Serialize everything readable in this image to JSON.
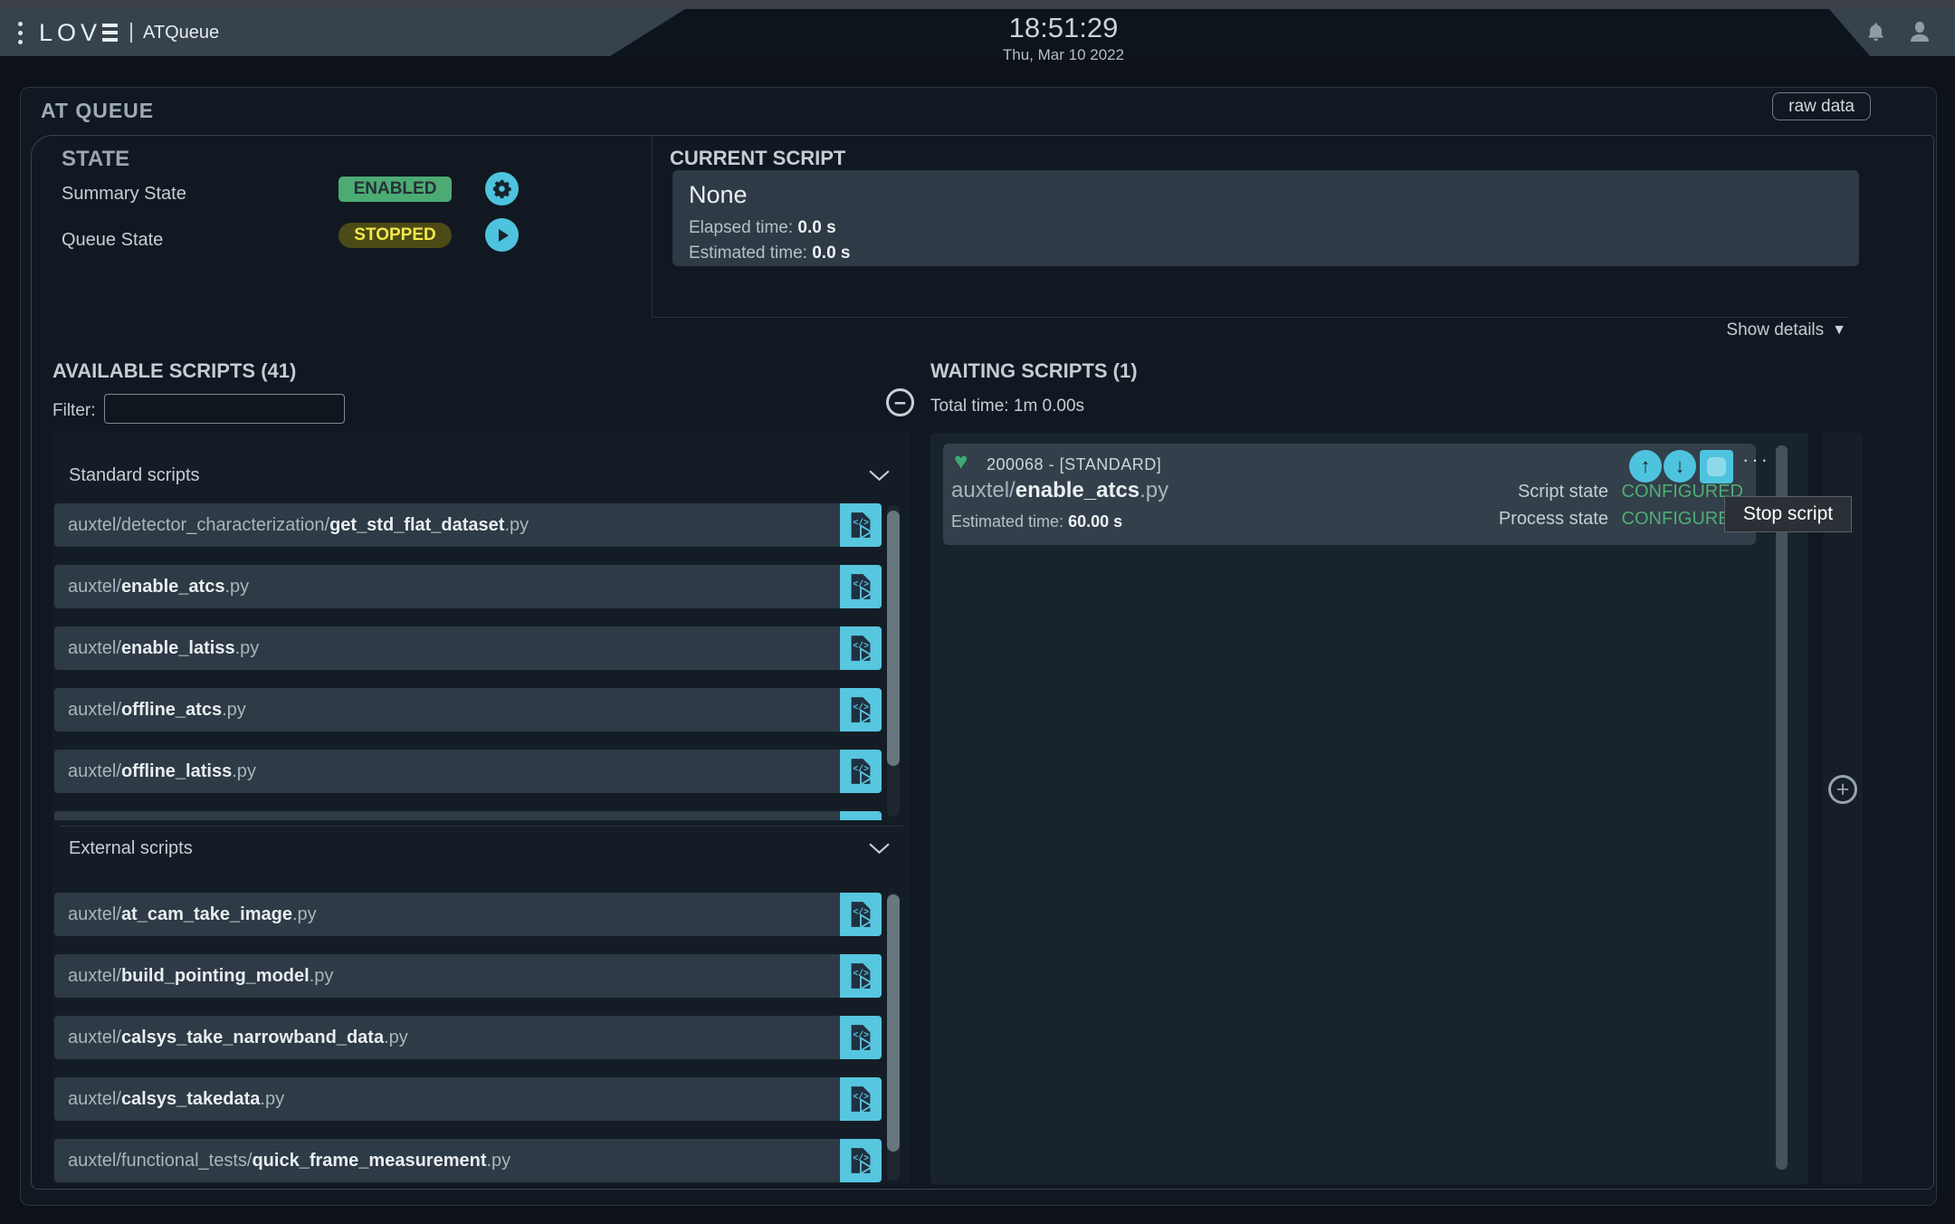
{
  "header": {
    "menu_icon": "kebab-menu",
    "logo_text": "LOV",
    "app_name": "ATQueue",
    "clock_time": "18:51:29",
    "clock_date": "Thu, Mar 10 2022"
  },
  "panel": {
    "title": "AT QUEUE",
    "raw_data_button": "raw data",
    "show_details": "Show details",
    "show_details_icon": "▼"
  },
  "state": {
    "title": "STATE",
    "summary_label": "Summary State",
    "summary_value": "ENABLED",
    "queue_label": "Queue State",
    "queue_value": "STOPPED"
  },
  "current_script": {
    "title": "CURRENT SCRIPT",
    "name": "None",
    "elapsed_label": "Elapsed time:",
    "elapsed_value": "0.0 s",
    "estimated_label": "Estimated time:",
    "estimated_value": "0.0 s"
  },
  "available": {
    "title": "AVAILABLE SCRIPTS (41)",
    "filter_label": "Filter:",
    "filter_value": "",
    "sections": [
      {
        "label": "Standard scripts",
        "scripts": [
          {
            "prefix": "auxtel/detector_characterization/",
            "name": "get_std_flat_dataset",
            "ext": ".py"
          },
          {
            "prefix": "auxtel/",
            "name": "enable_atcs",
            "ext": ".py"
          },
          {
            "prefix": "auxtel/",
            "name": "enable_latiss",
            "ext": ".py"
          },
          {
            "prefix": "auxtel/",
            "name": "offline_atcs",
            "ext": ".py"
          },
          {
            "prefix": "auxtel/",
            "name": "offline_latiss",
            "ext": ".py"
          }
        ]
      },
      {
        "label": "External scripts",
        "scripts": [
          {
            "prefix": "auxtel/",
            "name": "at_cam_take_image",
            "ext": ".py"
          },
          {
            "prefix": "auxtel/",
            "name": "build_pointing_model",
            "ext": ".py"
          },
          {
            "prefix": "auxtel/",
            "name": "calsys_take_narrowband_data",
            "ext": ".py"
          },
          {
            "prefix": "auxtel/",
            "name": "calsys_takedata",
            "ext": ".py"
          },
          {
            "prefix": "auxtel/functional_tests/",
            "name": "quick_frame_measurement",
            "ext": ".py"
          }
        ]
      }
    ]
  },
  "waiting": {
    "title": "WAITING SCRIPTS (1)",
    "total_time_label": "Total time:",
    "total_time_value": "1m 0.00s",
    "card": {
      "id": "200068",
      "separator": "-",
      "type_tag": "[STANDARD]",
      "prefix": "auxtel/",
      "name": "enable_atcs",
      "ext": ".py",
      "estimated_label": "Estimated time:",
      "estimated_value": "60.00 s",
      "script_state_label": "Script state",
      "script_state_value": "CONFIGURED",
      "process_state_label": "Process state",
      "process_state_value": "CONFIGURED",
      "more_icon": "···",
      "heart_icon": "♥"
    }
  },
  "tooltip": {
    "label": "Stop script"
  },
  "icons": {
    "minus": "−",
    "plus": "+",
    "up_arrow": "↑",
    "down_arrow": "↓"
  },
  "colors": {
    "accent_cyan": "#4ec3de",
    "status_green": "#4cab73",
    "status_yellow": "#f1e94b",
    "state_text_green": "#4fae74"
  }
}
